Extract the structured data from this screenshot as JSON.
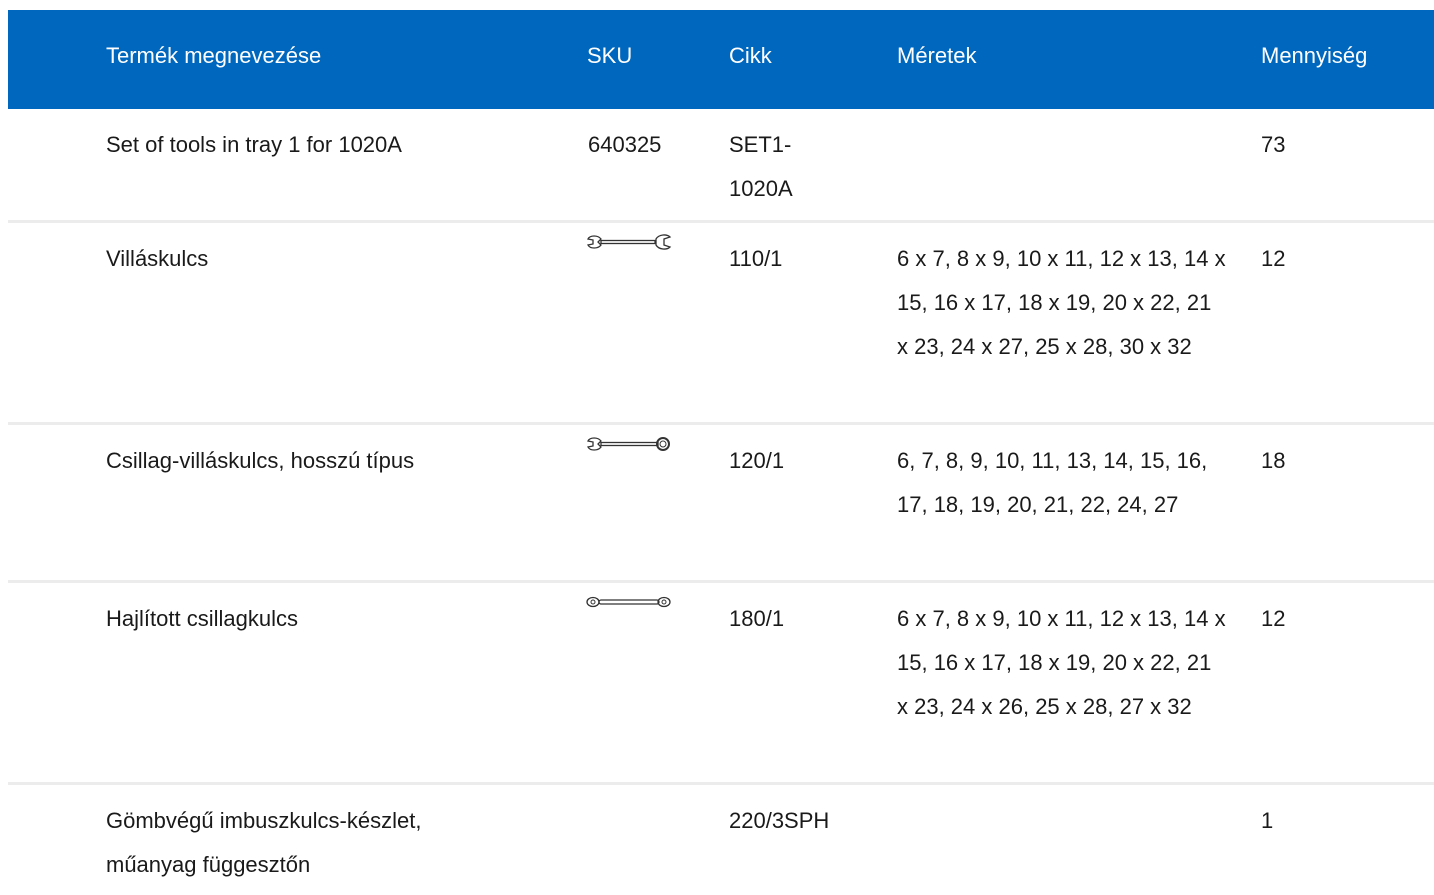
{
  "table": {
    "headers": {
      "name": "Termék megnevezése",
      "sku": "SKU",
      "cikk": "Cikk",
      "meretek": "Méretek",
      "qty": "Mennyiség"
    },
    "rows": [
      {
        "name": "Set of tools in tray 1 for 1020A",
        "sku": "640325",
        "cikk": "SET1-\n1020A",
        "meretek": "",
        "qty": "73",
        "icon": ""
      },
      {
        "name": "Villáskulcs",
        "sku": "",
        "cikk": "110/1",
        "meretek": "6 x 7, 8 x 9, 10 x 11, 12 x 13, 14 x 15, 16 x 17, 18 x 19, 20 x 22, 21 x 23, 24 x 27, 25 x 28, 30 x 32",
        "qty": "12",
        "icon": "open-end-wrench-icon"
      },
      {
        "name": "Csillag-villáskulcs, hosszú típus",
        "sku": "",
        "cikk": "120/1",
        "meretek": "6, 7, 8, 9, 10, 11, 13, 14, 15, 16, 17, 18, 19, 20, 21, 22, 24, 27",
        "qty": "18",
        "icon": "combination-wrench-icon"
      },
      {
        "name": "Hajlított csillagkulcs",
        "sku": "",
        "cikk": "180/1",
        "meretek": "6 x 7, 8 x 9, 10 x 11, 12 x 13, 14 x 15, 16 x 17, 18 x 19, 20 x 22, 21 x 23, 24 x 26, 25 x 28, 27 x 32",
        "qty": "12",
        "icon": "ring-wrench-icon"
      },
      {
        "name": "Gömbvégű imbuszkulcs-készlet, műanyag függesztőn",
        "sku": "",
        "cikk": "220/3SPH",
        "meretek": "",
        "qty": "1",
        "icon": ""
      }
    ]
  },
  "colors": {
    "header_bg": "#0067bf",
    "header_text": "#ffffff",
    "divider": "#ececec"
  }
}
